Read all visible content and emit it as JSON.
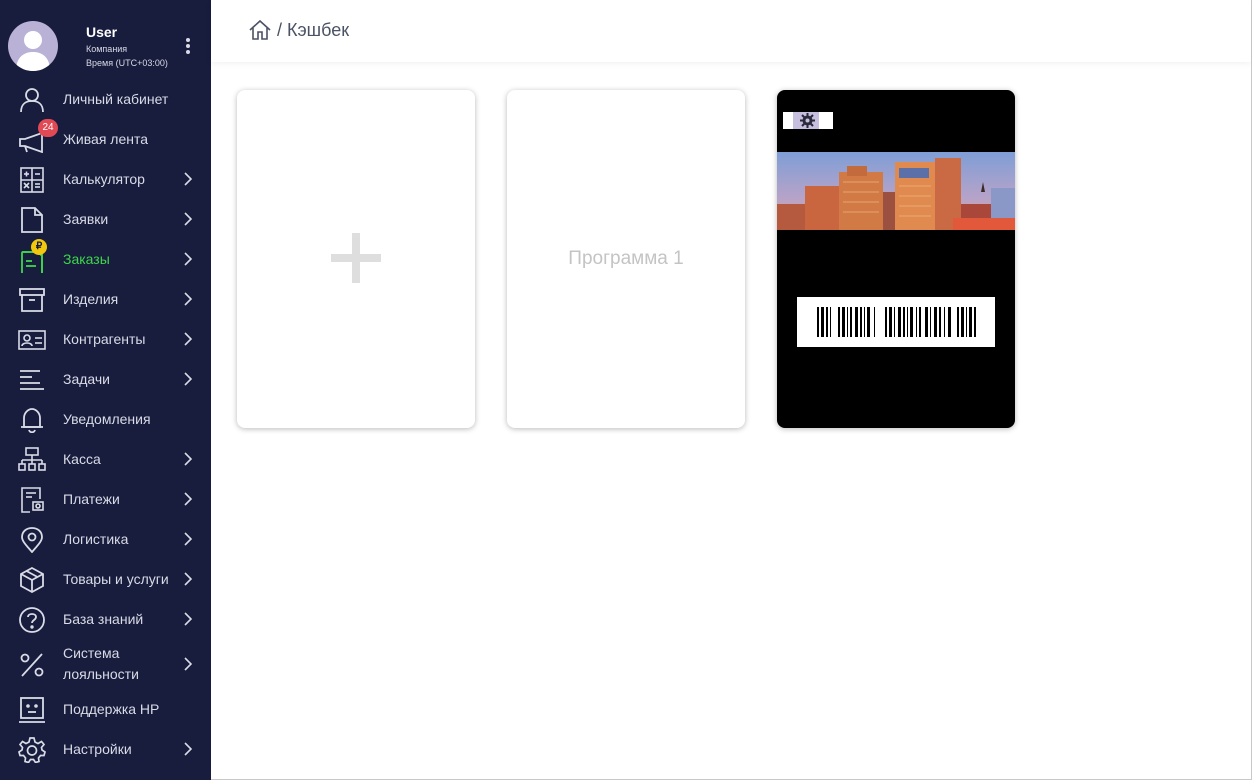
{
  "user": {
    "name": "User",
    "company": "Компания",
    "timezone": "Время (UTC+03:00)"
  },
  "sidebar": {
    "items": [
      {
        "label": "Личный кабинет",
        "icon": "user-icon",
        "chevron": false
      },
      {
        "label": "Живая лента",
        "icon": "megaphone-icon",
        "chevron": false,
        "badge": "24"
      },
      {
        "label": "Калькулятор",
        "icon": "calculator-icon",
        "chevron": true
      },
      {
        "label": "Заявки",
        "icon": "document-icon",
        "chevron": true
      },
      {
        "label": "Заказы",
        "icon": "order-icon",
        "chevron": true,
        "active": true,
        "badge": "₽"
      },
      {
        "label": "Изделия",
        "icon": "archive-icon",
        "chevron": true
      },
      {
        "label": "Контрагенты",
        "icon": "contact-card-icon",
        "chevron": true
      },
      {
        "label": "Задачи",
        "icon": "tasks-icon",
        "chevron": true
      },
      {
        "label": "Уведомления",
        "icon": "bell-icon",
        "chevron": false
      },
      {
        "label": "Касса",
        "icon": "sitemap-icon",
        "chevron": true
      },
      {
        "label": "Платежи",
        "icon": "receipt-icon",
        "chevron": true
      },
      {
        "label": "Логистика",
        "icon": "location-pin-icon",
        "chevron": true
      },
      {
        "label": "Товары и услуги",
        "icon": "box-icon",
        "chevron": true
      },
      {
        "label": "База знаний",
        "icon": "help-icon",
        "chevron": true
      },
      {
        "label": "Система лояльности",
        "icon": "percent-icon",
        "chevron": true
      },
      {
        "label": "Поддержка НР",
        "icon": "support-face-icon",
        "chevron": false
      },
      {
        "label": "Настройки",
        "icon": "gear-icon",
        "chevron": true
      }
    ]
  },
  "header": {
    "breadcrumb_separator": "/",
    "breadcrumb_current": "Кэшбек"
  },
  "cards": {
    "program_title": "Программа 1"
  },
  "colors": {
    "sidebar_bg": "#181c3d",
    "active": "#3ed64b",
    "badge": "#e14a54",
    "coin": "#f2c80f"
  }
}
